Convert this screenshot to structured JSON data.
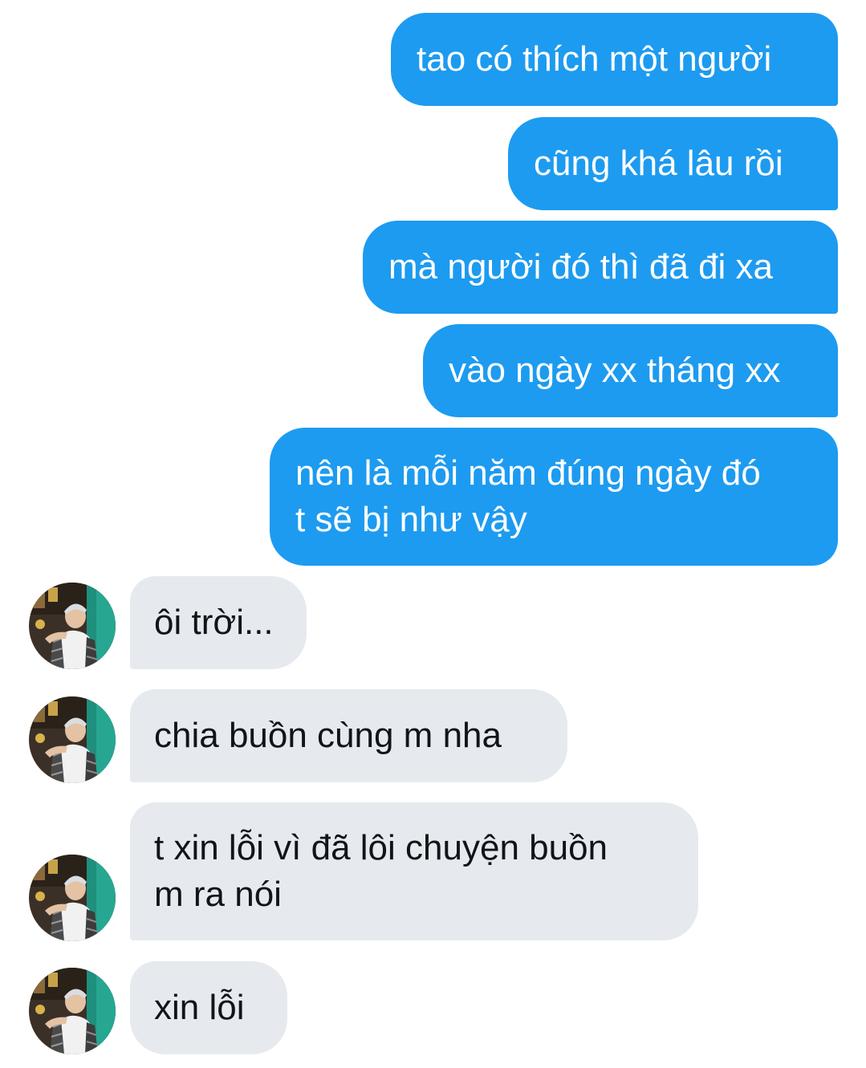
{
  "conversation": {
    "sent": [
      {
        "text": "tao có thích một người"
      },
      {
        "text": "cũng khá lâu rồi"
      },
      {
        "text": "mà người đó thì đã đi xa"
      },
      {
        "text": "vào ngày xx tháng xx"
      },
      {
        "text": "nên là mỗi năm đúng ngày đó\nt sẽ bị như vậy"
      }
    ],
    "received": [
      {
        "text": "ôi trời..."
      },
      {
        "text": "chia buồn cùng m nha"
      },
      {
        "text": "t xin lỗi vì đã lôi chuyện buồn\nm ra nói"
      },
      {
        "text": "xin lỗi"
      }
    ]
  },
  "colors": {
    "sent_bubble": "#1d9bf0",
    "received_bubble": "#e6eaee",
    "background": "#ffffff"
  },
  "icons": {
    "avatar": "contact-avatar-photo"
  }
}
